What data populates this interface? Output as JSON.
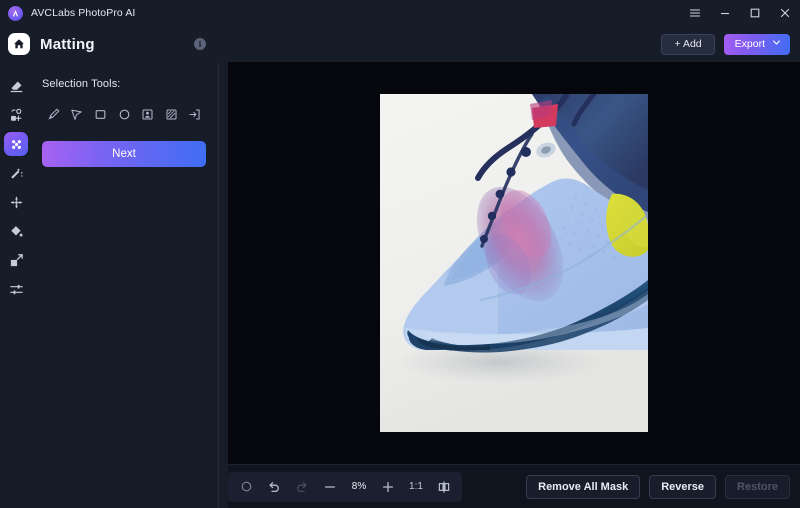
{
  "titlebar": {
    "app_name": "AVCLabs PhotoPro AI",
    "logo_icon": "avclabs-logo-icon",
    "controls": [
      {
        "name": "menu-button",
        "icon": "hamburger-menu-icon"
      },
      {
        "name": "minimize-button",
        "icon": "minimize-icon"
      },
      {
        "name": "maximize-button",
        "icon": "maximize-icon"
      },
      {
        "name": "close-button",
        "icon": "close-icon"
      }
    ]
  },
  "header": {
    "home_icon": "home-icon",
    "title": "Matting",
    "info_icon": "info-icon",
    "info_glyph": "i",
    "add_label": "+ Add",
    "export_label": "Export",
    "export_chevron_icon": "chevron-down-icon"
  },
  "rail": {
    "items": [
      {
        "name": "rail-item-eraser",
        "icon": "eraser-icon",
        "active": false
      },
      {
        "name": "rail-item-object-remove",
        "icon": "object-remove-icon",
        "active": false
      },
      {
        "name": "rail-item-matting",
        "icon": "matting-icon",
        "active": true
      },
      {
        "name": "rail-item-magic-wand",
        "icon": "magic-wand-icon",
        "active": false
      },
      {
        "name": "rail-item-enhance",
        "icon": "enhance-sparkle-icon",
        "active": false
      },
      {
        "name": "rail-item-color-fill",
        "icon": "paint-bucket-icon",
        "active": false
      },
      {
        "name": "rail-item-resize",
        "icon": "resize-expand-icon",
        "active": false
      },
      {
        "name": "rail-item-adjust",
        "icon": "sliders-adjust-icon",
        "active": false
      }
    ]
  },
  "panel": {
    "section_label": "Selection Tools:",
    "tools": [
      {
        "name": "tool-brush",
        "icon": "brush-icon"
      },
      {
        "name": "tool-lasso-cursor",
        "icon": "cursor-arrow-icon"
      },
      {
        "name": "tool-rectangle-select",
        "icon": "rectangle-icon"
      },
      {
        "name": "tool-ellipse-select",
        "icon": "ellipse-icon"
      },
      {
        "name": "tool-subject-select",
        "icon": "person-box-icon"
      },
      {
        "name": "tool-background-select",
        "icon": "hatched-box-icon"
      },
      {
        "name": "tool-import-selection",
        "icon": "arrow-into-box-icon"
      }
    ],
    "next_label": "Next"
  },
  "canvas": {
    "image_alt": "sneaker-photo",
    "background_color": "#05070c"
  },
  "bottombar": {
    "zoom_tools": [
      {
        "name": "reset-button",
        "icon": "reset-circle-icon",
        "label": "",
        "disabled": false
      },
      {
        "name": "undo-button",
        "icon": "undo-icon",
        "label": "",
        "disabled": false
      },
      {
        "name": "redo-button",
        "icon": "redo-icon",
        "label": "",
        "disabled": true
      },
      {
        "name": "zoom-out-button",
        "icon": "minus-icon",
        "label": "",
        "disabled": false
      }
    ],
    "zoom_value": "8%",
    "zoom_in": {
      "name": "zoom-in-button",
      "icon": "plus-icon"
    },
    "actual_size": {
      "name": "actual-size-button",
      "label": "1:1"
    },
    "compare": {
      "name": "compare-split-button",
      "icon": "compare-split-icon"
    },
    "actions": [
      {
        "name": "remove-all-mask-button",
        "label": "Remove All Mask",
        "disabled": false
      },
      {
        "name": "reverse-button",
        "label": "Reverse",
        "disabled": false
      },
      {
        "name": "restore-button",
        "label": "Restore",
        "disabled": true
      }
    ]
  },
  "colors": {
    "accent_purple": "#a45cf0",
    "accent_blue": "#3f6ef3",
    "panel_bg": "#171c29",
    "canvas_bg": "#05070c",
    "bottom_bg": "#10141e"
  }
}
